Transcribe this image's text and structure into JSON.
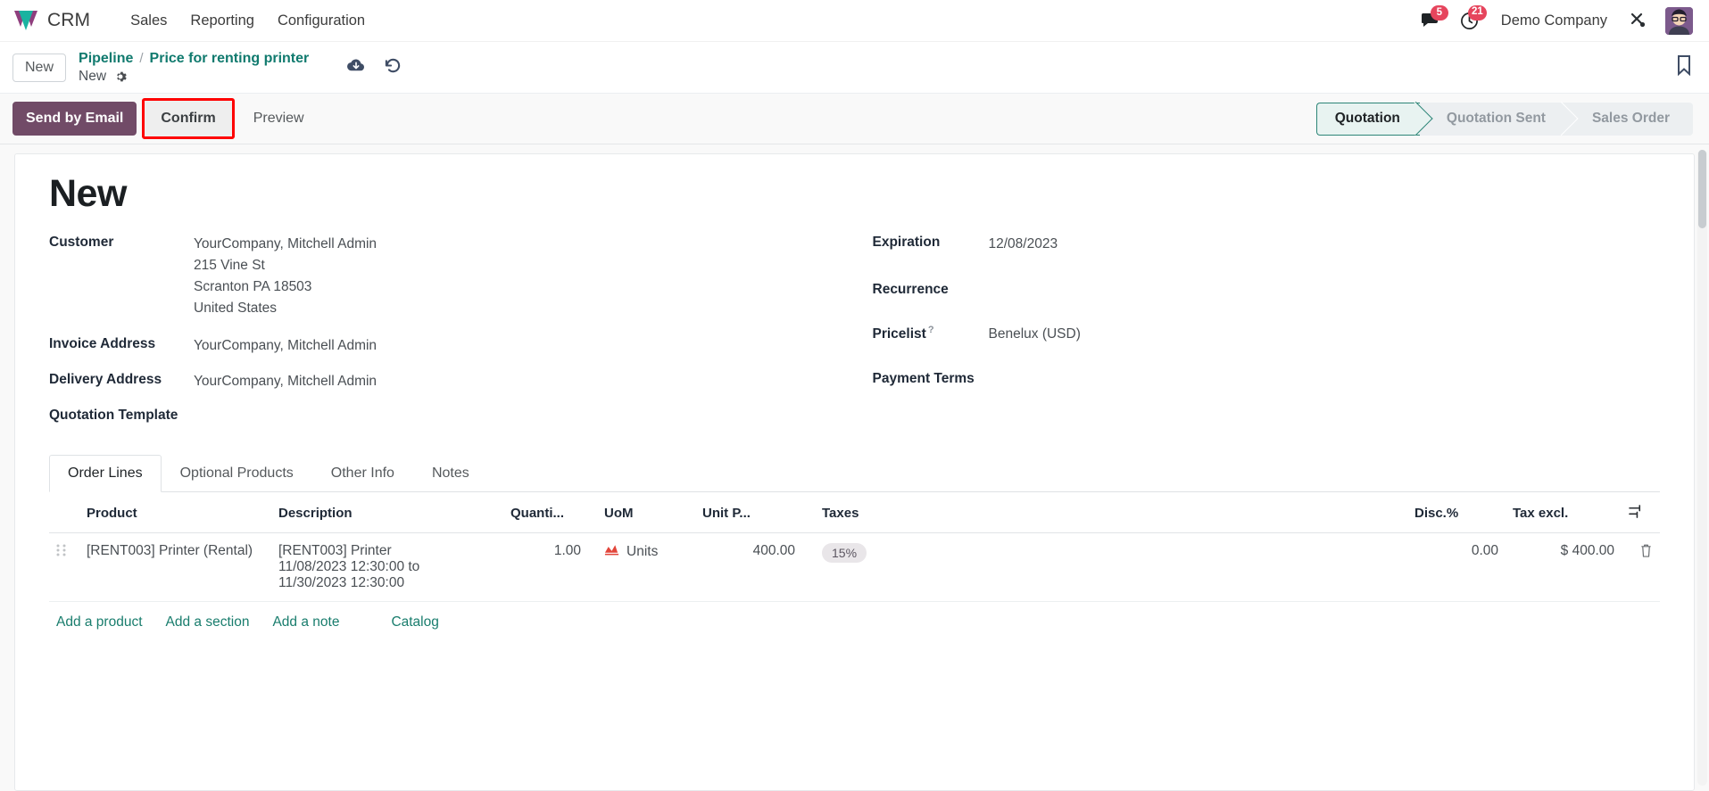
{
  "navbar": {
    "brand": "CRM",
    "logo_icon": "odoo-logo-icon",
    "menus": [
      {
        "label": "Sales"
      },
      {
        "label": "Reporting"
      },
      {
        "label": "Configuration"
      }
    ],
    "messages_icon": "messages-icon",
    "messages_count": "5",
    "activities_icon": "clock-activities-icon",
    "activities_count": "21",
    "company": "Demo Company",
    "tools_icon": "debug-tools-icon",
    "avatar_icon": "user-avatar"
  },
  "breadcrumb": {
    "new_button": "New",
    "root": "Pipeline",
    "separator": "/",
    "current": "Price for renting printer",
    "sub_label": "New",
    "gear_icon": "gear-icon",
    "save_icon": "cloud-save-icon",
    "discard_icon": "discard-undo-icon",
    "bookmark_icon": "bookmark-icon"
  },
  "control_panel": {
    "send_by_email": "Send by Email",
    "confirm": "Confirm",
    "preview": "Preview",
    "highlight_color": "#fe0000",
    "primary_color": "#714b67",
    "statuses": [
      {
        "label": "Quotation",
        "active": true
      },
      {
        "label": "Quotation Sent",
        "active": false
      },
      {
        "label": "Sales Order",
        "active": false
      }
    ]
  },
  "form": {
    "title": "New",
    "left_fields": [
      {
        "label": "Customer",
        "lines": [
          "YourCompany, Mitchell Admin",
          "215 Vine St",
          "Scranton PA 18503",
          "United States"
        ]
      },
      {
        "label": "Invoice Address",
        "lines": [
          "YourCompany, Mitchell Admin"
        ]
      },
      {
        "label": "Delivery Address",
        "lines": [
          "YourCompany, Mitchell Admin"
        ]
      },
      {
        "label": "Quotation Template",
        "lines": [
          ""
        ]
      }
    ],
    "right_fields": [
      {
        "label": "Expiration",
        "value": "12/08/2023",
        "help": false
      },
      {
        "label": "Recurrence",
        "value": "",
        "help": false
      },
      {
        "label": "Pricelist",
        "value": "Benelux (USD)",
        "help": true
      },
      {
        "label": "Payment Terms",
        "value": "",
        "help": false
      }
    ],
    "help_marker": "?"
  },
  "notebook": {
    "tabs": [
      {
        "label": "Order Lines",
        "active": true
      },
      {
        "label": "Optional Products",
        "active": false
      },
      {
        "label": "Other Info",
        "active": false
      },
      {
        "label": "Notes",
        "active": false
      }
    ]
  },
  "order_lines": {
    "columns": [
      "Product",
      "Description",
      "Quanti...",
      "UoM",
      "Unit P...",
      "Taxes",
      "Disc.%",
      "Tax excl."
    ],
    "options_icon": "column-options-icon",
    "rows": [
      {
        "drag_icon": "drag-handle-icon",
        "product": "[RENT003] Printer (Rental)",
        "description_main": "[RENT003] Printer",
        "description_line2": "11/08/2023 12:30:00 to",
        "description_line3": "11/30/2023 12:30:00",
        "quantity": "1.00",
        "uom_icon": "rental-chart-icon",
        "uom": "Units",
        "unit_price": "400.00",
        "taxes": "15%",
        "discount": "0.00",
        "tax_excl": "$ 400.00",
        "delete_icon": "trash-icon"
      }
    ],
    "add_links": [
      {
        "label": "Add a product"
      },
      {
        "label": "Add a section"
      },
      {
        "label": "Add a note"
      },
      {
        "label": "Catalog"
      }
    ]
  }
}
